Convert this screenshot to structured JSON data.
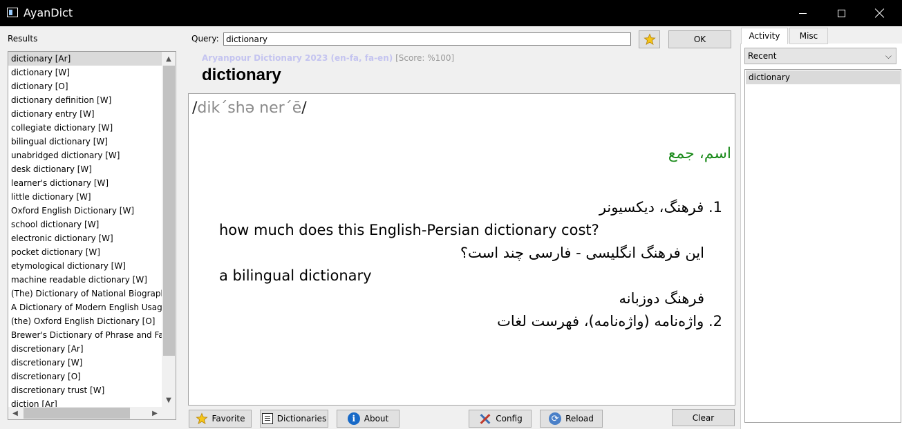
{
  "window": {
    "title": "AyanDict"
  },
  "results": {
    "label": "Results",
    "items": [
      "dictionary [Ar]",
      "dictionary [W]",
      "dictionary [O]",
      "dictionary definition [W]",
      "dictionary entry [W]",
      "collegiate dictionary [W]",
      "bilingual dictionary [W]",
      "unabridged dictionary [W]",
      "desk dictionary [W]",
      "learner's dictionary [W]",
      "little dictionary [W]",
      "Oxford English Dictionary [W]",
      "school dictionary [W]",
      "electronic dictionary [W]",
      "pocket dictionary [W]",
      "etymological dictionary [W]",
      "machine readable dictionary [W]",
      "(The) Dictionary of National Biography",
      "A Dictionary of Modern English Usage",
      "(the) Oxford English Dictionary [O]",
      "Brewer's Dictionary of Phrase and Fab",
      "discretionary [Ar]",
      "discretionary [W]",
      "discretionary [O]",
      "discretionary trust [W]",
      "diction [Ar]"
    ]
  },
  "query": {
    "label": "Query:",
    "value": "dictionary",
    "ok_label": "OK"
  },
  "entry": {
    "source": "Aryanpour Dictionary 2023 (en-fa, fa-en)",
    "score": "[Score: %100]",
    "word": "dictionary",
    "pron_open": "/",
    "pron_text": "dik´shə ner´ē",
    "pron_close": "/",
    "pos": "اسم، جمع",
    "sense1": "1. فرهنگ، دیکسیونر",
    "example1_en": "how much does this English-Persian dictionary cost?",
    "example1_fa": "این فرهنگ انگلیسی - فارسی چند است؟",
    "example2_en": "a bilingual dictionary",
    "example2_fa": "فرهنگ دوزبانه",
    "sense2": "2. واژه‌نامه (واژه‌نامه)، فهرست لغات"
  },
  "buttons": {
    "favorite": "Favorite",
    "dictionaries": "Dictionaries",
    "about": "About",
    "config": "Config",
    "reload": "Reload",
    "clear": "Clear"
  },
  "side": {
    "tabs": [
      "Activity",
      "Misc"
    ],
    "recent_label": "Recent",
    "recent_items": [
      "dictionary"
    ]
  },
  "colors": {
    "source": "#c4c4f0",
    "pos": "#1a8a1a",
    "star": "#f5c518"
  }
}
